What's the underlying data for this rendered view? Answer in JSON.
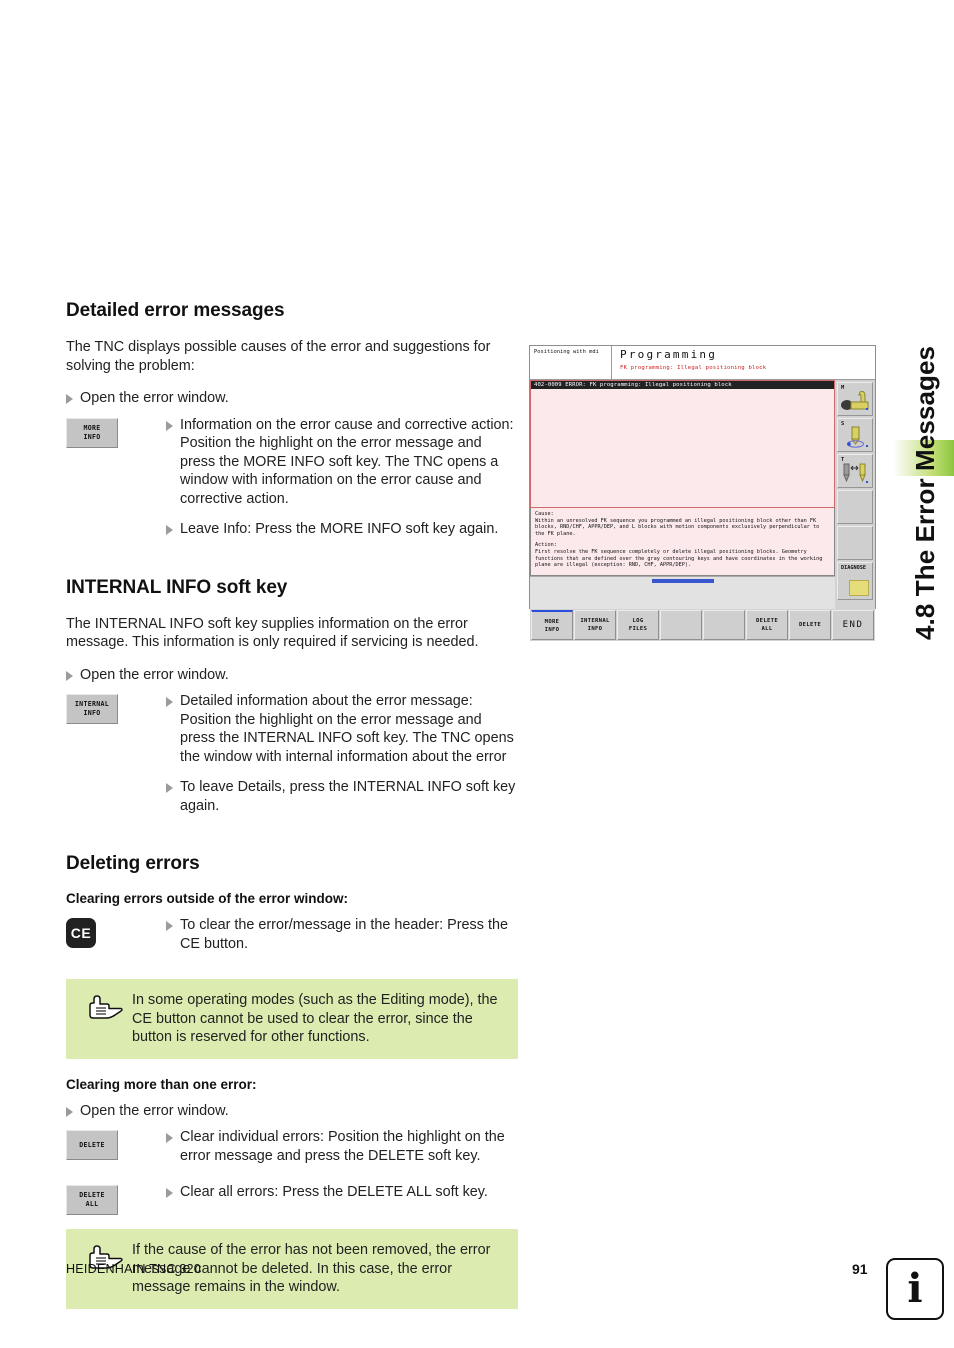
{
  "chapter": {
    "title": "4.8 The Error Messages",
    "accent_color": "#8cc63f"
  },
  "sections": [
    {
      "id": "detailed-error-messages",
      "title": "Detailed error messages",
      "intro": "The TNC displays possible causes of the error and suggestions for solving the problem:",
      "open_window_bullet": "Open the error window.",
      "key": {
        "line1": "MORE",
        "line2": "INFO"
      },
      "bullets": [
        "Information on the error cause and corrective action: Position the highlight on the error message and press the MORE INFO soft key. The TNC opens a window with information on the error cause and corrective action.",
        "Leave Info: Press the MORE INFO soft key again."
      ]
    },
    {
      "id": "internal-info-soft-key",
      "title": "INTERNAL INFO soft key",
      "intro": "The INTERNAL INFO soft key supplies information on the error message. This information is only required if servicing is needed.",
      "open_window_bullet": "Open the error window.",
      "key": {
        "line1": "INTERNAL",
        "line2": "INFO"
      },
      "bullets": [
        "Detailed information about the error message: Position the highlight on the error message and press the INTERNAL INFO soft key. The TNC opens the window with internal information about the error",
        "To leave Details, press the INTERNAL INFO soft key again."
      ]
    }
  ],
  "deleting": {
    "title": "Deleting errors",
    "sub1": "Clearing errors outside of the error window:",
    "ce_key_label": "CE",
    "ce_bullet": "To clear the error/message in the header: Press the CE button.",
    "note1": "In some operating modes (such as the Editing mode), the CE button cannot be used to clear the error, since the button is reserved for other functions.",
    "sub2": "Clearing more than one error:",
    "open_window_bullet": "Open the error window.",
    "delete_key": {
      "line1": "DELETE",
      "line2": ""
    },
    "delete_all_key": {
      "line1": "DELETE",
      "line2": "ALL"
    },
    "bullet_delete": "Clear individual errors: Position the highlight on the error message and press the DELETE soft key.",
    "bullet_delete_all": "Clear all errors: Press the DELETE ALL soft key.",
    "note2": "If the cause of the error has not been removed, the error message cannot be deleted. In this case, the error message remains in the window."
  },
  "tnc_screen": {
    "mode_label": "Positioning\nwith mdi",
    "title": "Programming",
    "subtitle": "FK programming: Illegal positioning block",
    "error_line": "402-0009 ERROR:  FK programming: Illegal positioning block",
    "cause_label": "Cause:",
    "cause_text": "Within an unresolved FK sequence you programmed an illegal positioning block other than FK blocks, RND/CHF, APPR/DEP, and L blocks with motion components exclusively perpendicular to the FK plane.",
    "action_label": "Action:",
    "action_text": "First resolve the FK sequence completely or delete illegal positioning blocks. Geometry functions that are defined over the gray contouring keys and have coordinates in the working plane are illegal (exception: RND, CHF, APPR/DEP).",
    "side_labels": {
      "m": "M",
      "s": "S",
      "t": "T",
      "diagnose": "DIAGNOSE"
    },
    "softkeys": [
      {
        "line1": "MORE",
        "line2": "INFO"
      },
      {
        "line1": "INTERNAL",
        "line2": "INFO"
      },
      {
        "line1": "LOG",
        "line2": "FILES"
      },
      {
        "line1": "",
        "line2": ""
      },
      {
        "line1": "",
        "line2": ""
      },
      {
        "line1": "DELETE",
        "line2": "ALL"
      },
      {
        "line1": "DELETE",
        "line2": ""
      },
      {
        "line1": "END",
        "line2": ""
      }
    ]
  },
  "footer": {
    "brand": "HEIDENHAIN TNC 320",
    "page": "91",
    "info_glyph": "i"
  }
}
